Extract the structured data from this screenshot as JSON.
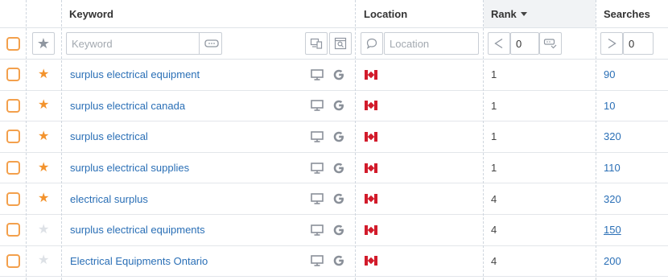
{
  "header": {
    "keyword": "Keyword",
    "location": "Location",
    "rank": "Rank",
    "searches": "Searches"
  },
  "filters": {
    "keyword_placeholder": "Keyword",
    "location_placeholder": "Location",
    "rank_value": "0",
    "searches_value": "0",
    "rank_operator": "<",
    "searches_operator": ">"
  },
  "colors": {
    "accent": "#f3932d",
    "link": "#2a6fb6",
    "flag_red": "#d21b2b"
  },
  "rows": [
    {
      "keyword": "surplus electrical equipment",
      "starred": true,
      "rank": "1",
      "searches": "90",
      "country": "CA",
      "device": "desktop-icon",
      "engine": "google-icon"
    },
    {
      "keyword": "surplus electrical canada",
      "starred": true,
      "rank": "1",
      "searches": "10",
      "country": "CA",
      "device": "desktop-icon",
      "engine": "google-icon"
    },
    {
      "keyword": "surplus electrical",
      "starred": true,
      "rank": "1",
      "searches": "320",
      "country": "CA",
      "device": "desktop-icon",
      "engine": "google-icon"
    },
    {
      "keyword": "surplus electrical supplies",
      "starred": true,
      "rank": "1",
      "searches": "110",
      "country": "CA",
      "device": "desktop-icon",
      "engine": "google-icon"
    },
    {
      "keyword": "electrical surplus",
      "starred": true,
      "rank": "4",
      "searches": "320",
      "country": "CA",
      "device": "desktop-icon",
      "engine": "google-icon"
    },
    {
      "keyword": "surplus electrical equipments",
      "starred": false,
      "rank": "4",
      "searches": "150",
      "country": "CA",
      "device": "desktop-icon",
      "engine": "google-icon"
    },
    {
      "keyword": "Electrical Equipments Ontario",
      "starred": false,
      "rank": "4",
      "searches": "200",
      "country": "CA",
      "device": "desktop-icon",
      "engine": "google-icon"
    }
  ]
}
